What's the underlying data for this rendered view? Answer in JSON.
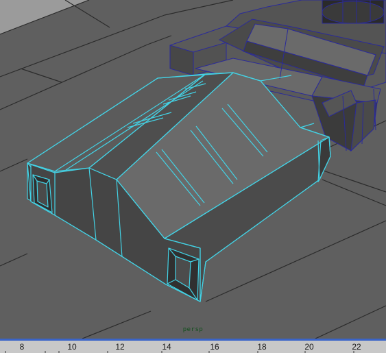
{
  "viewport": {
    "camera_label": "persp",
    "colors": {
      "background": "#5f5f5f",
      "ground_light": "#9a9a9a",
      "grid_line": "#2a2a2a",
      "selected_wire": "#43d3e6",
      "unselected_wire": "#2a2a9a",
      "face_light": "#6e6e6e",
      "face_mid": "#555555",
      "face_dark": "#444444"
    },
    "objects": [
      {
        "name": "tent-building",
        "selected": true
      },
      {
        "name": "background-building",
        "selected": false
      }
    ]
  },
  "timeline": {
    "accent_color": "#3a64c8",
    "frame_labels": [
      "8",
      "10",
      "12",
      "14",
      "16",
      "18",
      "20",
      "22"
    ]
  }
}
